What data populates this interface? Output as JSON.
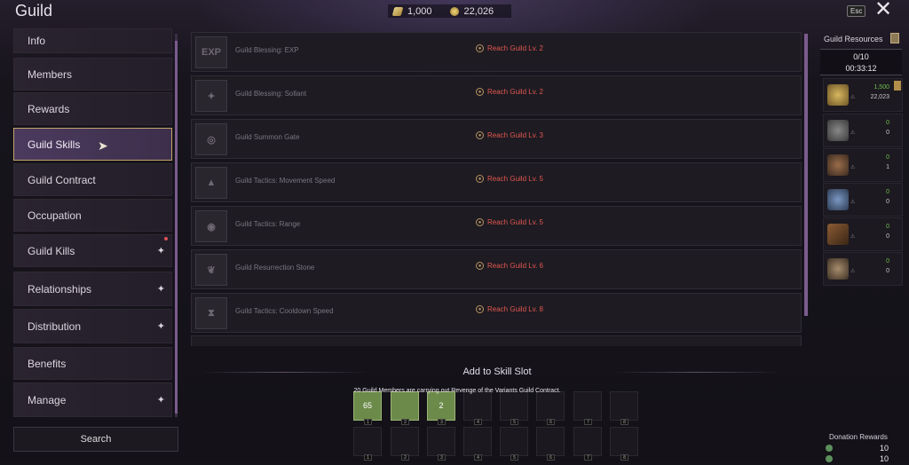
{
  "header": {
    "title": "Guild",
    "currency": [
      {
        "icon": "gem-currency-icon",
        "value": "1,000"
      },
      {
        "icon": "gold-coin-icon",
        "value": "22,026"
      }
    ],
    "esc_label": "Esc",
    "close_label": "✕"
  },
  "sidebar": {
    "items": [
      {
        "label": "Info",
        "chevron": false
      },
      {
        "label": "Members",
        "chevron": false
      },
      {
        "label": "Rewards",
        "chevron": false
      },
      {
        "label": "Guild Skills",
        "chevron": false,
        "active": true
      },
      {
        "label": "Guild Contract",
        "chevron": false
      },
      {
        "label": "Occupation",
        "chevron": false
      },
      {
        "label": "Guild Kills",
        "chevron": true,
        "badge": true
      },
      {
        "label": "Relationships",
        "chevron": true
      },
      {
        "label": "Distribution",
        "chevron": true
      },
      {
        "label": "Benefits",
        "chevron": false
      },
      {
        "label": "Manage",
        "chevron": true
      }
    ],
    "search_label": "Search"
  },
  "skills": [
    {
      "name": "Guild Blessing: EXP",
      "requirement": "Reach Guild Lv. 2",
      "icon_text": "EXP"
    },
    {
      "name": "Guild Blessing: Sollant",
      "requirement": "Reach Guild Lv. 2"
    },
    {
      "name": "Guild Summon Gate",
      "requirement": "Reach Guild Lv. 3"
    },
    {
      "name": "Guild Tactics: Movement Speed",
      "requirement": "Reach Guild Lv. 5"
    },
    {
      "name": "Guild Tactics: Range",
      "requirement": "Reach Guild Lv. 5"
    },
    {
      "name": "Guild Resurrection Stone",
      "requirement": "Reach Guild Lv. 6"
    },
    {
      "name": "Guild Tactics: Cooldown Speed",
      "requirement": "Reach Guild Lv. 8"
    }
  ],
  "skill_slot": {
    "title": "Add to Skill Slot",
    "notice": "20 Guild Members are carrying out Revenge of the Variants Guild Contract.",
    "row1": [
      {
        "num": "1",
        "count": "65",
        "filled": true
      },
      {
        "num": "2",
        "count": "",
        "filled": true
      },
      {
        "num": "3",
        "count": "2",
        "filled": true
      },
      {
        "num": "4"
      },
      {
        "num": "5"
      },
      {
        "num": "6"
      },
      {
        "num": "7"
      },
      {
        "num": "8"
      }
    ],
    "row2": [
      {
        "num": "1"
      },
      {
        "num": "2"
      },
      {
        "num": "3"
      },
      {
        "num": "4"
      },
      {
        "num": "5"
      },
      {
        "num": "6"
      },
      {
        "num": "7"
      },
      {
        "num": "8"
      }
    ]
  },
  "resources": {
    "title": "Guild Resources",
    "count": "0/10",
    "timer": "00:33:12",
    "items": [
      {
        "icon": "coin",
        "top": "1,500",
        "bottom": "22,023",
        "bookmark": true
      },
      {
        "icon": "gray",
        "top": "0",
        "bottom": "0"
      },
      {
        "icon": "brown",
        "top": "0",
        "bottom": "1"
      },
      {
        "icon": "blue",
        "top": "0",
        "bottom": "0"
      },
      {
        "icon": "wood",
        "top": "0",
        "bottom": "0"
      },
      {
        "icon": "ore",
        "top": "0",
        "bottom": "0"
      }
    ],
    "donation_title": "Donation Rewards",
    "donations": [
      "10",
      "10"
    ]
  }
}
